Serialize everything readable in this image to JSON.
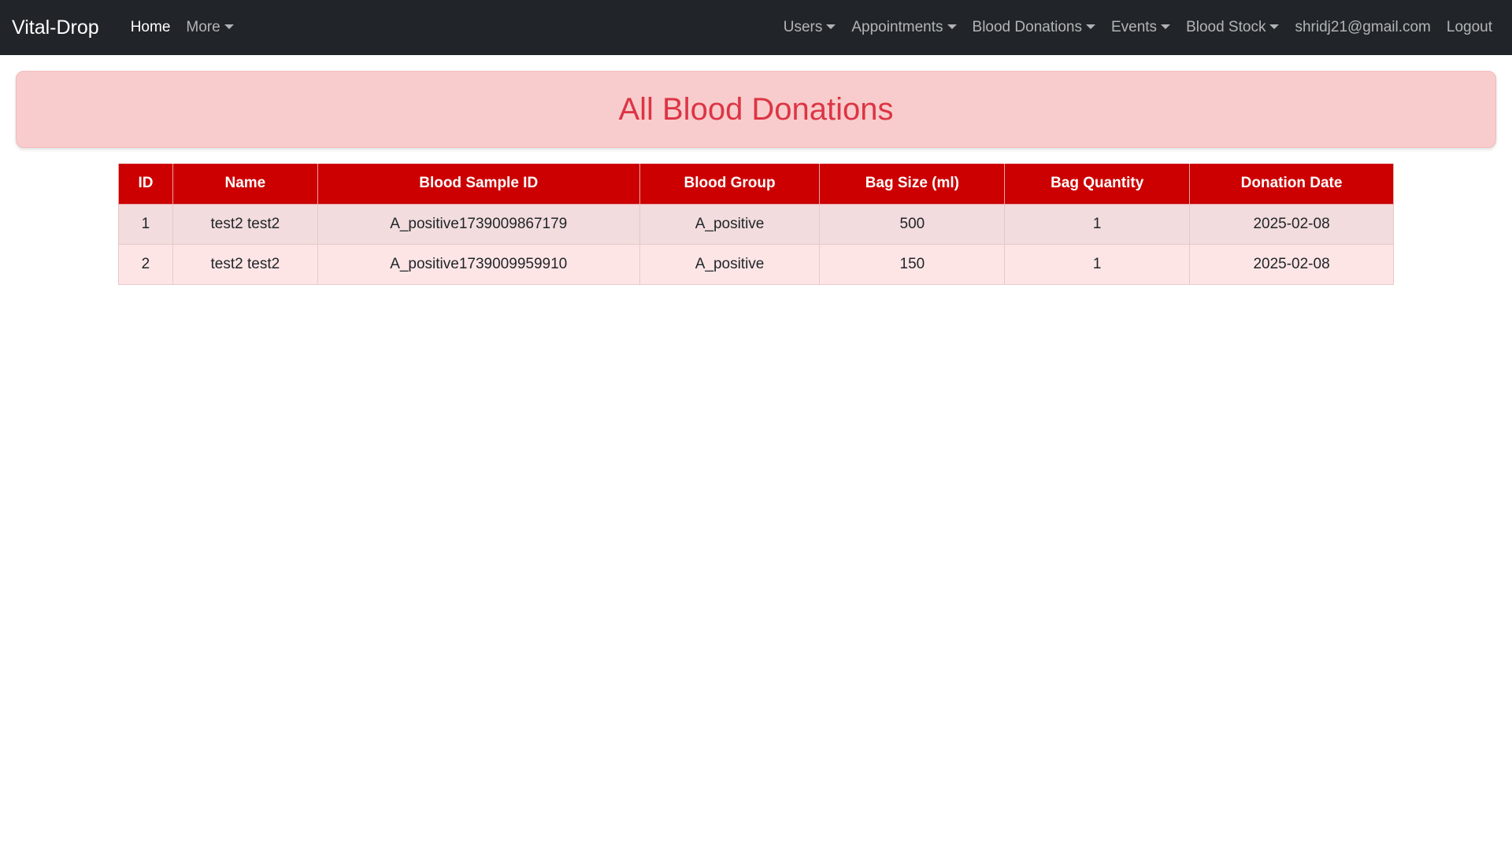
{
  "navbar": {
    "brand": "Vital-Drop",
    "left_items": [
      {
        "label": "Home"
      },
      {
        "label": "More"
      }
    ],
    "right_items": [
      {
        "label": "Users"
      },
      {
        "label": "Appointments"
      },
      {
        "label": "Blood Donations"
      },
      {
        "label": "Events"
      },
      {
        "label": "Blood Stock"
      },
      {
        "label": "shridj21@gmail.com"
      },
      {
        "label": "Logout"
      }
    ]
  },
  "page": {
    "title": "All Blood Donations"
  },
  "table": {
    "headers": [
      "ID",
      "Name",
      "Blood Sample ID",
      "Blood Group",
      "Bag Size (ml)",
      "Bag Quantity",
      "Donation Date"
    ],
    "rows": [
      [
        "1",
        "test2 test2",
        "A_positive1739009867179",
        "A_positive",
        "500",
        "1",
        "2025-02-08"
      ],
      [
        "2",
        "test2 test2",
        "A_positive1739009959910",
        "A_positive",
        "150",
        "1",
        "2025-02-08"
      ]
    ]
  },
  "colors": {
    "navbar_bg": "#212529",
    "banner_bg": "#f8cccc",
    "title_color": "#dc3545",
    "table_header_bg": "#cc0000"
  }
}
